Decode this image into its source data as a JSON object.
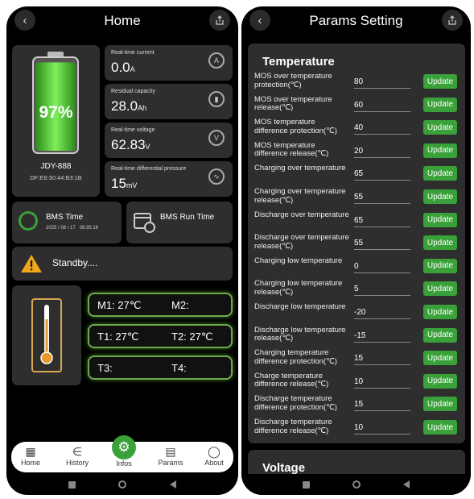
{
  "left": {
    "title": "Home",
    "battery": {
      "percent": "97%",
      "device_name": "JDY-888",
      "mac": "DF:E8:30:44:B3:1B",
      "level": 0.97
    },
    "metrics": [
      {
        "label": "Real-time current",
        "value": "0.0",
        "unit": "A",
        "icon": "current-gauge-icon"
      },
      {
        "label": "Residual capacity",
        "value": "28.0",
        "unit": "Ah",
        "icon": "battery-capacity-icon"
      },
      {
        "label": "Real-time voltage",
        "value": "62.83",
        "unit": "V",
        "icon": "voltage-gauge-icon"
      },
      {
        "label": "Real-time differential pressure",
        "value": "15",
        "unit": "mV",
        "icon": "pulse-gauge-icon"
      }
    ],
    "bms_time": {
      "label": "BMS Time",
      "value": "2025 / 06 / 17   08:35:16"
    },
    "bms_run_time": {
      "label": "BMS Run Time"
    },
    "status": "Standby....",
    "temps": [
      {
        "a": "M1: 27℃",
        "b": "M2:"
      },
      {
        "a": "T1: 27℃",
        "b": "T2: 27℃"
      },
      {
        "a": "T3:",
        "b": "T4:"
      }
    ],
    "nav": [
      "Home",
      "History",
      "Infos",
      "Params",
      "About"
    ]
  },
  "right": {
    "title": "Params Setting",
    "section_temperature": "Temperature",
    "section_voltage": "Voltage",
    "update_label": "Update",
    "params": [
      {
        "label": "MOS over temperature protection(℃)",
        "value": "80"
      },
      {
        "label": "MOS over temperature release(℃)",
        "value": "60"
      },
      {
        "label": "MOS temperature difference protection(℃)",
        "value": "40"
      },
      {
        "label": "MOS temperature difference release(℃)",
        "value": "20"
      },
      {
        "label": "Charging over temperature",
        "value": "65"
      },
      {
        "label": "Charging over temperature release(℃)",
        "value": "55"
      },
      {
        "label": "Discharge over temperature",
        "value": "65"
      },
      {
        "label": "Discharge over temperature release(℃)",
        "value": "55"
      },
      {
        "label": "Charging low temperature",
        "value": "0"
      },
      {
        "label": "Charging low temperature release(℃)",
        "value": "5"
      },
      {
        "label": "Discharge low temperature",
        "value": "-20"
      },
      {
        "label": "Discharge low temperature release(℃)",
        "value": "-15"
      },
      {
        "label": "Charging temperature difference protection(℃)",
        "value": "15"
      },
      {
        "label": "Charge temperature difference release(℃)",
        "value": "10"
      },
      {
        "label": "Discharge temperature difference protection(℃)",
        "value": "15"
      },
      {
        "label": "Discharge temperature difference release(℃)",
        "value": "10"
      }
    ]
  }
}
